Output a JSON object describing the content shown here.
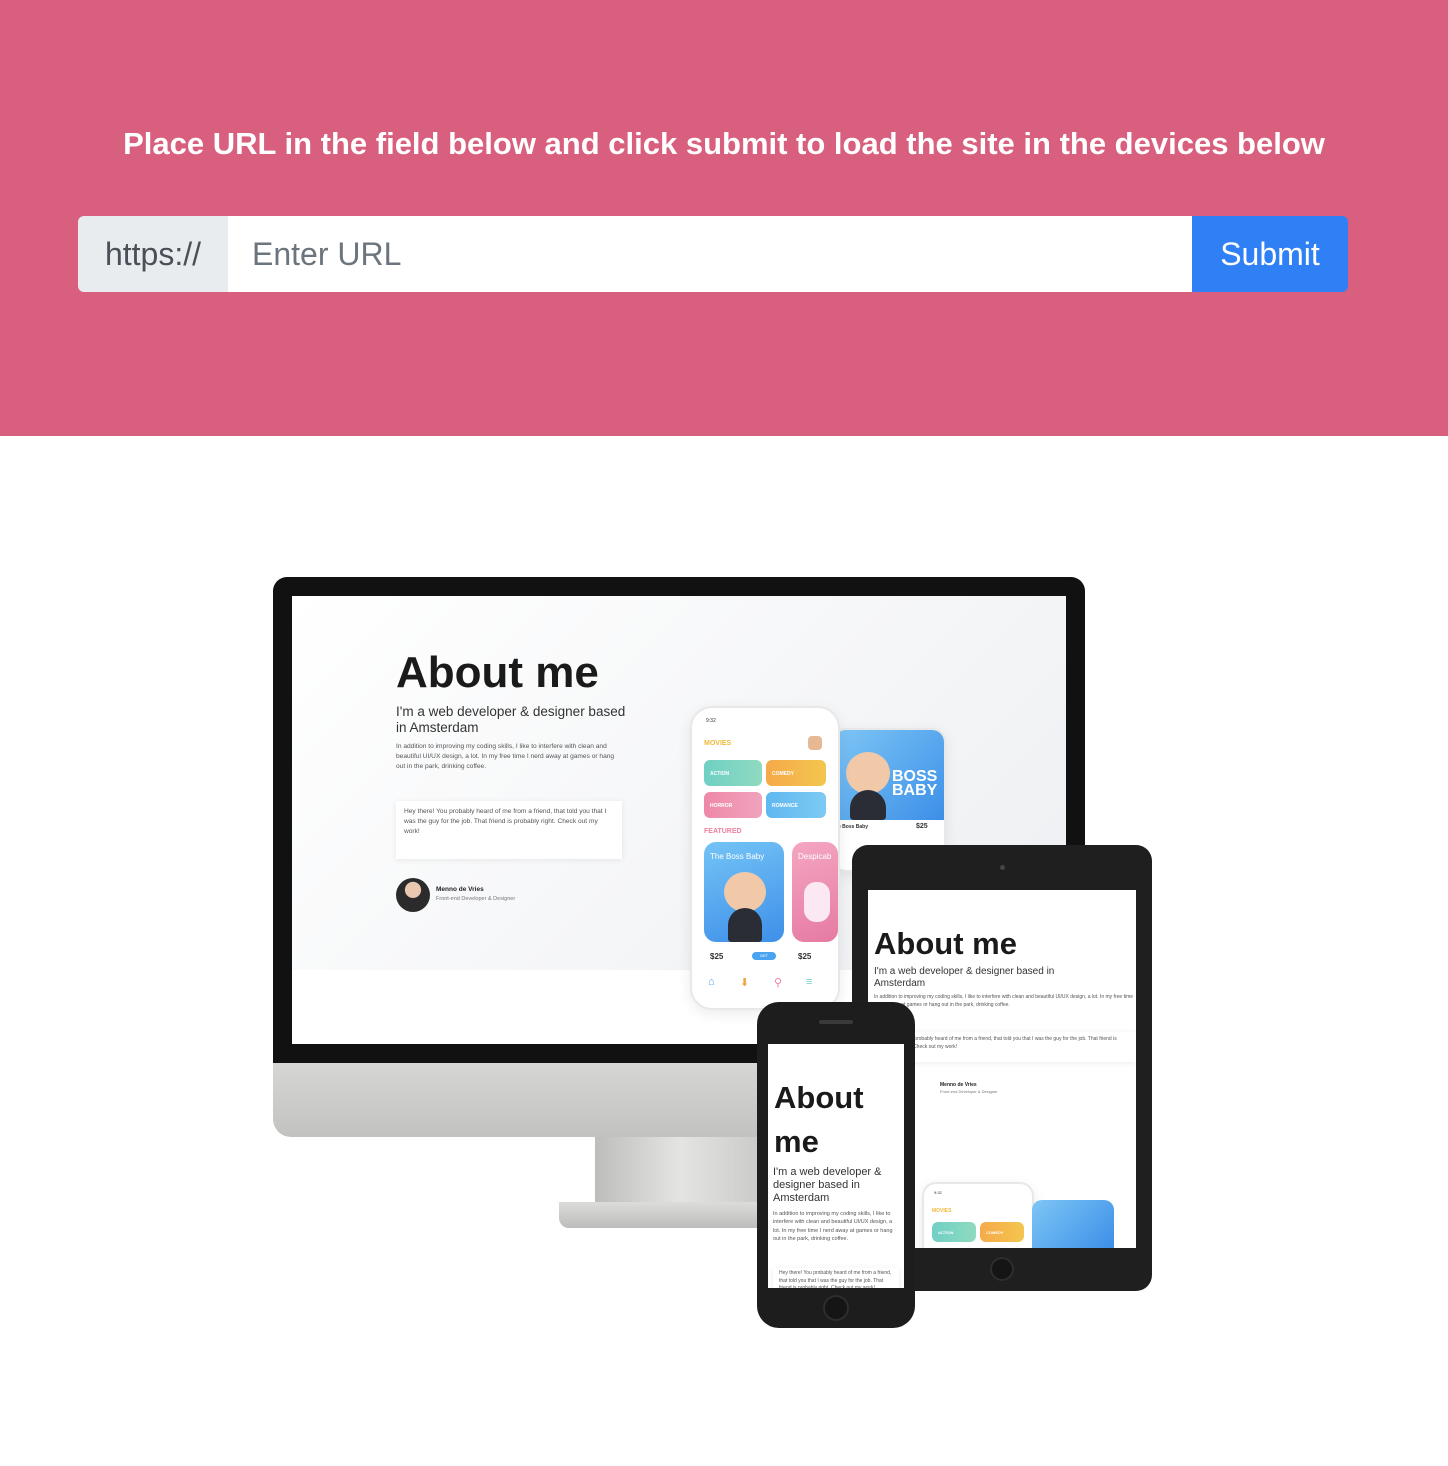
{
  "header": {
    "headline": "Place URL in the field below and click submit to load the site in the devices below",
    "url_prefix": "https://",
    "url_placeholder": "Enter URL",
    "url_value": "",
    "submit_label": "Submit"
  },
  "colors": {
    "hero_background": "#d85f7e",
    "submit_button": "#2f80f5",
    "prefix_background": "#e9ecef"
  },
  "preview": {
    "title": "About me",
    "title_phone_line1": "About",
    "title_phone_line2": "me",
    "subtitle": "I'm a web developer & designer based in Amsterdam",
    "body": "In addition to improving my coding skills, I like to interfere with clean and beautiful UI/UX design, a lot. In my free time I nerd away at games or hang out in the park, drinking coffee.",
    "quote": "Hey there! You probably heard of me from a friend, that told you that I was the guy for the job. That friend is probably right. Check out my work!",
    "author_name": "Menno de Vries",
    "author_role": "Front-end Developer & Designer",
    "app": {
      "time": "9:32",
      "movies_label": "MOVIES",
      "featured_label": "FEATURED",
      "categories": [
        "ACTION",
        "COMEDY",
        "HORROR",
        "ROMANCE"
      ],
      "card1_title": "The Boss Baby",
      "card2_title": "Despicab",
      "price1": "$25",
      "price2": "$25",
      "get_label": "GET",
      "side_title": "e Boss Baby",
      "side_price": "$25"
    }
  }
}
